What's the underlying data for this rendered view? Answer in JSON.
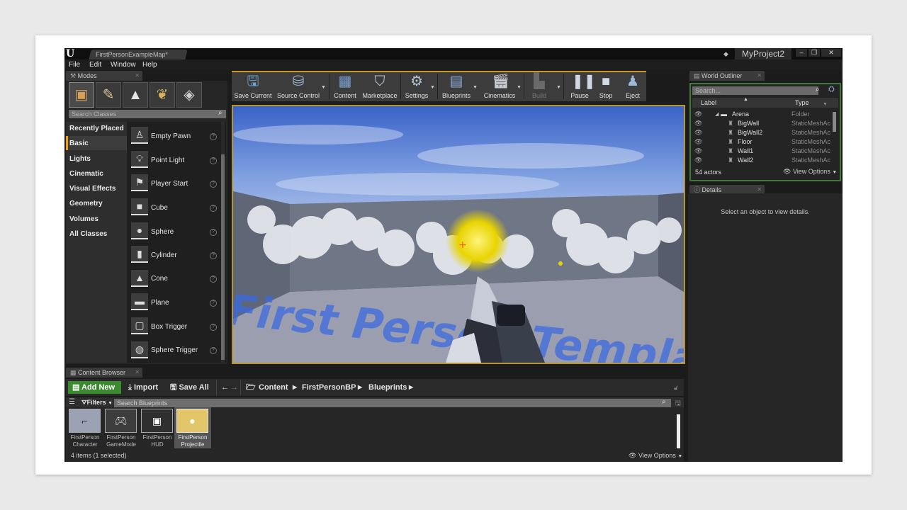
{
  "app": {
    "logo": "U",
    "map_tab": "FirstPersonExampleMap*",
    "project_name": "MyProject2",
    "window_controls": [
      "–",
      "❐",
      "✕"
    ]
  },
  "menu": [
    "File",
    "Edit",
    "Window",
    "Help"
  ],
  "modes": {
    "tab_label": "Modes",
    "mode_icons": [
      "place-mode-icon",
      "paint-mode-icon",
      "landscape-mode-icon",
      "foliage-mode-icon",
      "geometry-mode-icon"
    ],
    "search_placeholder": "Search Classes",
    "categories": [
      "Recently Placed",
      "Basic",
      "Lights",
      "Cinematic",
      "Visual Effects",
      "Geometry",
      "Volumes",
      "All Classes"
    ],
    "selected_category": "Basic",
    "items": [
      "Empty Pawn",
      "Point Light",
      "Player Start",
      "Cube",
      "Sphere",
      "Cylinder",
      "Cone",
      "Plane",
      "Box Trigger",
      "Sphere Trigger"
    ],
    "item_icons": [
      "pawn-icon",
      "lightbulb-icon",
      "flag-icon",
      "cube-icon",
      "sphere-icon",
      "cylinder-icon",
      "cone-icon",
      "plane-icon",
      "box-trigger-icon",
      "sphere-trigger-icon"
    ]
  },
  "toolbar": {
    "buttons": [
      "Save Current",
      "Source Control",
      "Content",
      "Marketplace",
      "Settings",
      "Blueprints",
      "Cinematics",
      "Build",
      "Pause",
      "Stop",
      "Eject"
    ],
    "icons": [
      "save-icon",
      "source-control-icon",
      "content-icon",
      "marketplace-icon",
      "settings-icon",
      "blueprints-icon",
      "cinematics-icon",
      "build-icon",
      "pause-icon",
      "stop-icon",
      "eject-icon"
    ]
  },
  "viewport": {
    "floor_text": "First Person Template"
  },
  "outliner": {
    "tab_label": "World Outliner",
    "search_placeholder": "Search...",
    "columns": [
      "Label",
      "Type"
    ],
    "rows": [
      {
        "label": "Arena",
        "type": "Folder"
      },
      {
        "label": "BigWall",
        "type": "StaticMeshAc"
      },
      {
        "label": "BigWall2",
        "type": "StaticMeshAc"
      },
      {
        "label": "Floor",
        "type": "StaticMeshAc"
      },
      {
        "label": "Wall1",
        "type": "StaticMeshAc"
      },
      {
        "label": "Wall2",
        "type": "StaticMeshAc"
      }
    ],
    "actor_count": "54 actors",
    "view_options": "View Options"
  },
  "details": {
    "tab_label": "Details",
    "empty_text": "Select an object to view details."
  },
  "content_browser": {
    "tab_label": "Content Browser",
    "add_new": "Add New",
    "import": "Import",
    "save_all": "Save All",
    "breadcrumb": [
      "Content",
      "FirstPersonBP",
      "Blueprints"
    ],
    "filters": "Filters",
    "search_placeholder": "Search Blueprints",
    "assets": [
      {
        "line1": "FirstPerson",
        "line2": "Character"
      },
      {
        "line1": "FirstPerson",
        "line2": "GameMode"
      },
      {
        "line1": "FirstPerson",
        "line2": "HUD"
      },
      {
        "line1": "FirstPerson",
        "line2": "Projectile"
      }
    ],
    "status": "4 items (1 selected)",
    "view_options": "View Options"
  },
  "colors": {
    "accent_orange": "#f0a000",
    "add_new_green": "#3c8a2f",
    "outliner_border": "#3f7a3a"
  }
}
